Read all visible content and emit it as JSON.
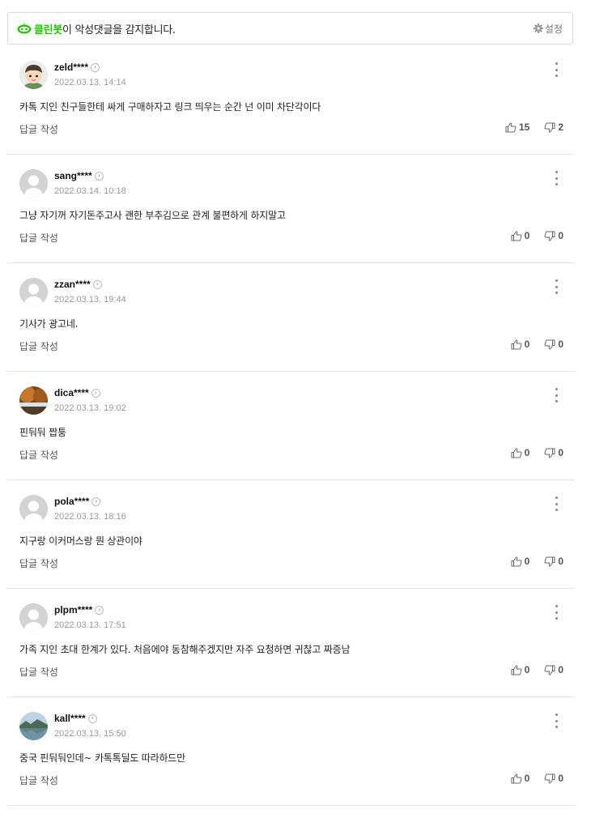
{
  "cleanbot": {
    "brand": "클린봇",
    "message": "이 악성댓글을 감지합니다.",
    "settings_label": "설정"
  },
  "reply_label": "답글 작성",
  "comments": [
    {
      "nick": "zeld****",
      "date": "2022.03.13. 14:14",
      "text": "카톡 지인 친구들한테 싸게 구매하자고 링크 띄우는 순간 넌 이미 차단각이다",
      "likes": "15",
      "dislikes": "2",
      "avatar": "character"
    },
    {
      "nick": "sang****",
      "date": "2022.03.14. 10:18",
      "text": "그냥 자기꺼 자기돈주고사 괜한 부추김으로 관계 불편하게 하지말고",
      "likes": "0",
      "dislikes": "0",
      "avatar": "default"
    },
    {
      "nick": "zzan****",
      "date": "2022.03.13. 19:44",
      "text": "기사가 광고네.",
      "likes": "0",
      "dislikes": "0",
      "avatar": "default"
    },
    {
      "nick": "dica****",
      "date": "2022.03.13. 19:02",
      "text": "핀둬둬 짭퉁",
      "likes": "0",
      "dislikes": "0",
      "avatar": "landscape-autumn"
    },
    {
      "nick": "pola****",
      "date": "2022.03.13. 18:16",
      "text": "지구랑 이커머스랑 뭔 상관이야",
      "likes": "0",
      "dislikes": "0",
      "avatar": "default"
    },
    {
      "nick": "plpm****",
      "date": "2022.03.13. 17:51",
      "text": "가족 지인 초대 한계가 있다. 처음에야 동참해주겠지만 자주 요청하면 귀찮고 짜증남",
      "likes": "0",
      "dislikes": "0",
      "avatar": "default"
    },
    {
      "nick": "kall****",
      "date": "2022.03.13. 15:50",
      "text": "중국 핀둬둬인데~ 카톡톡딜도 따라하드만",
      "likes": "0",
      "dislikes": "0",
      "avatar": "landscape-lake"
    }
  ]
}
